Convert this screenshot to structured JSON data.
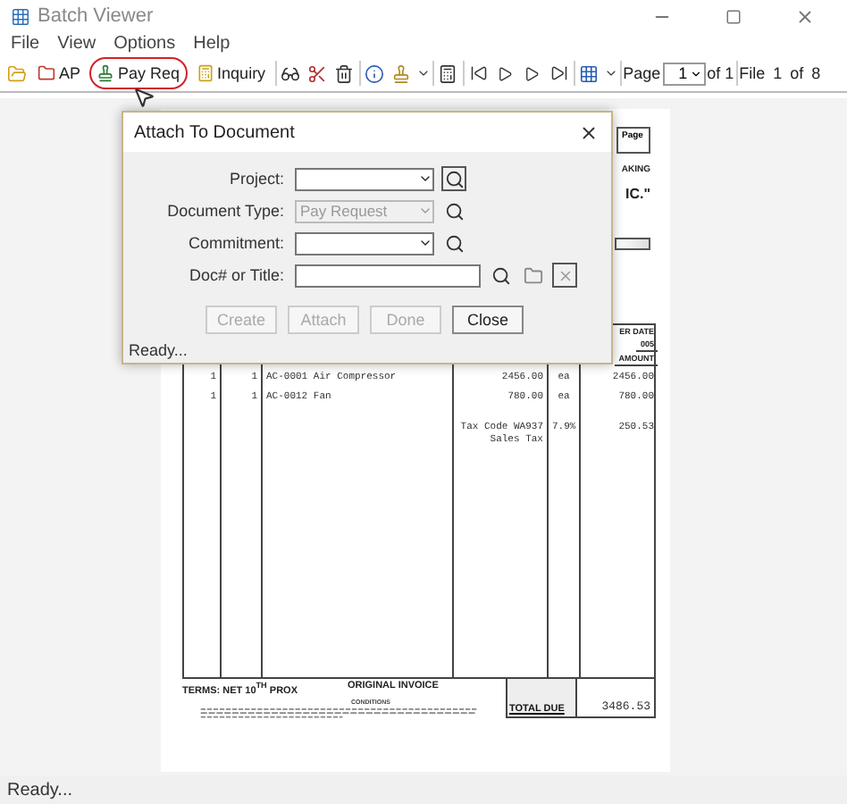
{
  "window": {
    "title": "Batch Viewer"
  },
  "menu": [
    "File",
    "View",
    "Options",
    "Help"
  ],
  "toolbar": {
    "buttons": [
      {
        "label": "AP",
        "highlighted": false
      },
      {
        "label": "Pay Req",
        "highlighted": true
      },
      {
        "label": "Inquiry",
        "highlighted": false
      }
    ],
    "page_label": "Page",
    "page_value": "1",
    "page_of": "of 1",
    "file_info": "File 1 of 8"
  },
  "document": {
    "header_fragments": [
      "Page",
      "AKING",
      "IC.\""
    ],
    "table_header_fragments": [
      "ER DATE",
      "005",
      "AMOUNT"
    ],
    "rows": [
      {
        "qty": "1",
        "column_2": "1",
        "description": "AC-0001 Air Compressor",
        "price": "2456.00",
        "unit": "ea",
        "amount": "2456.00"
      },
      {
        "qty": "1",
        "column_2": "1",
        "description": "AC-0012 Fan",
        "price": "780.00",
        "unit": "ea",
        "amount": "780.00"
      },
      {
        "price": "Tax Code WA937 Sales Tax",
        "unit": "7.9%",
        "amount": "250.53"
      }
    ],
    "terms": "TERMS: NET 10$^{TH}$ PROX",
    "invoice_label": "ORIGINAL INVOICE",
    "conditions_title": "CONDITIONS",
    "total_label": "TOTAL DUE",
    "total": "3486.53"
  },
  "dialog": {
    "title": "Attach To Document",
    "fields": [
      {
        "label": "Project:",
        "kind": "combo",
        "disabled": false
      },
      {
        "label": "Document Type:",
        "kind": "combo",
        "value": "Pay Request",
        "disabled": true
      },
      {
        "label": "Commitment:",
        "kind": "combo",
        "disabled": false
      },
      {
        "label": "Doc# or Title:",
        "kind": "text"
      }
    ],
    "buttons": [
      {
        "label": "Create",
        "disabled": true
      },
      {
        "label": "Attach",
        "disabled": true
      },
      {
        "label": "Done",
        "disabled": true
      },
      {
        "label": "Close",
        "disabled": false
      }
    ],
    "status": "Ready..."
  },
  "status_bar": "Ready..."
}
